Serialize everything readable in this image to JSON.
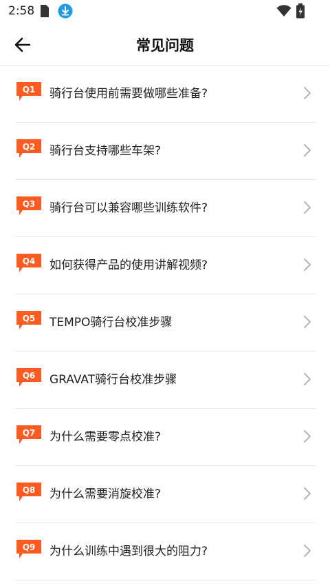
{
  "status_bar": {
    "time": "2:58"
  },
  "header": {
    "title": "常见问题",
    "back_icon": "arrow-left-icon"
  },
  "accent_color": "#ff5a1f",
  "faq": [
    {
      "badge": "Q1",
      "question": "骑行台使用前需要做哪些准备?"
    },
    {
      "badge": "Q2",
      "question": "骑行台支持哪些车架?"
    },
    {
      "badge": "Q3",
      "question": "骑行台可以兼容哪些训练软件?"
    },
    {
      "badge": "Q4",
      "question": "如何获得产品的使用讲解视频?"
    },
    {
      "badge": "Q5",
      "question": "TEMPO骑行台校准步骤"
    },
    {
      "badge": "Q6",
      "question": "GRAVAT骑行台校准步骤"
    },
    {
      "badge": "Q7",
      "question": "为什么需要零点校准?"
    },
    {
      "badge": "Q8",
      "question": "为什么需要消旋校准?"
    },
    {
      "badge": "Q9",
      "question": "为什么训练中遇到很大的阻力?"
    }
  ]
}
